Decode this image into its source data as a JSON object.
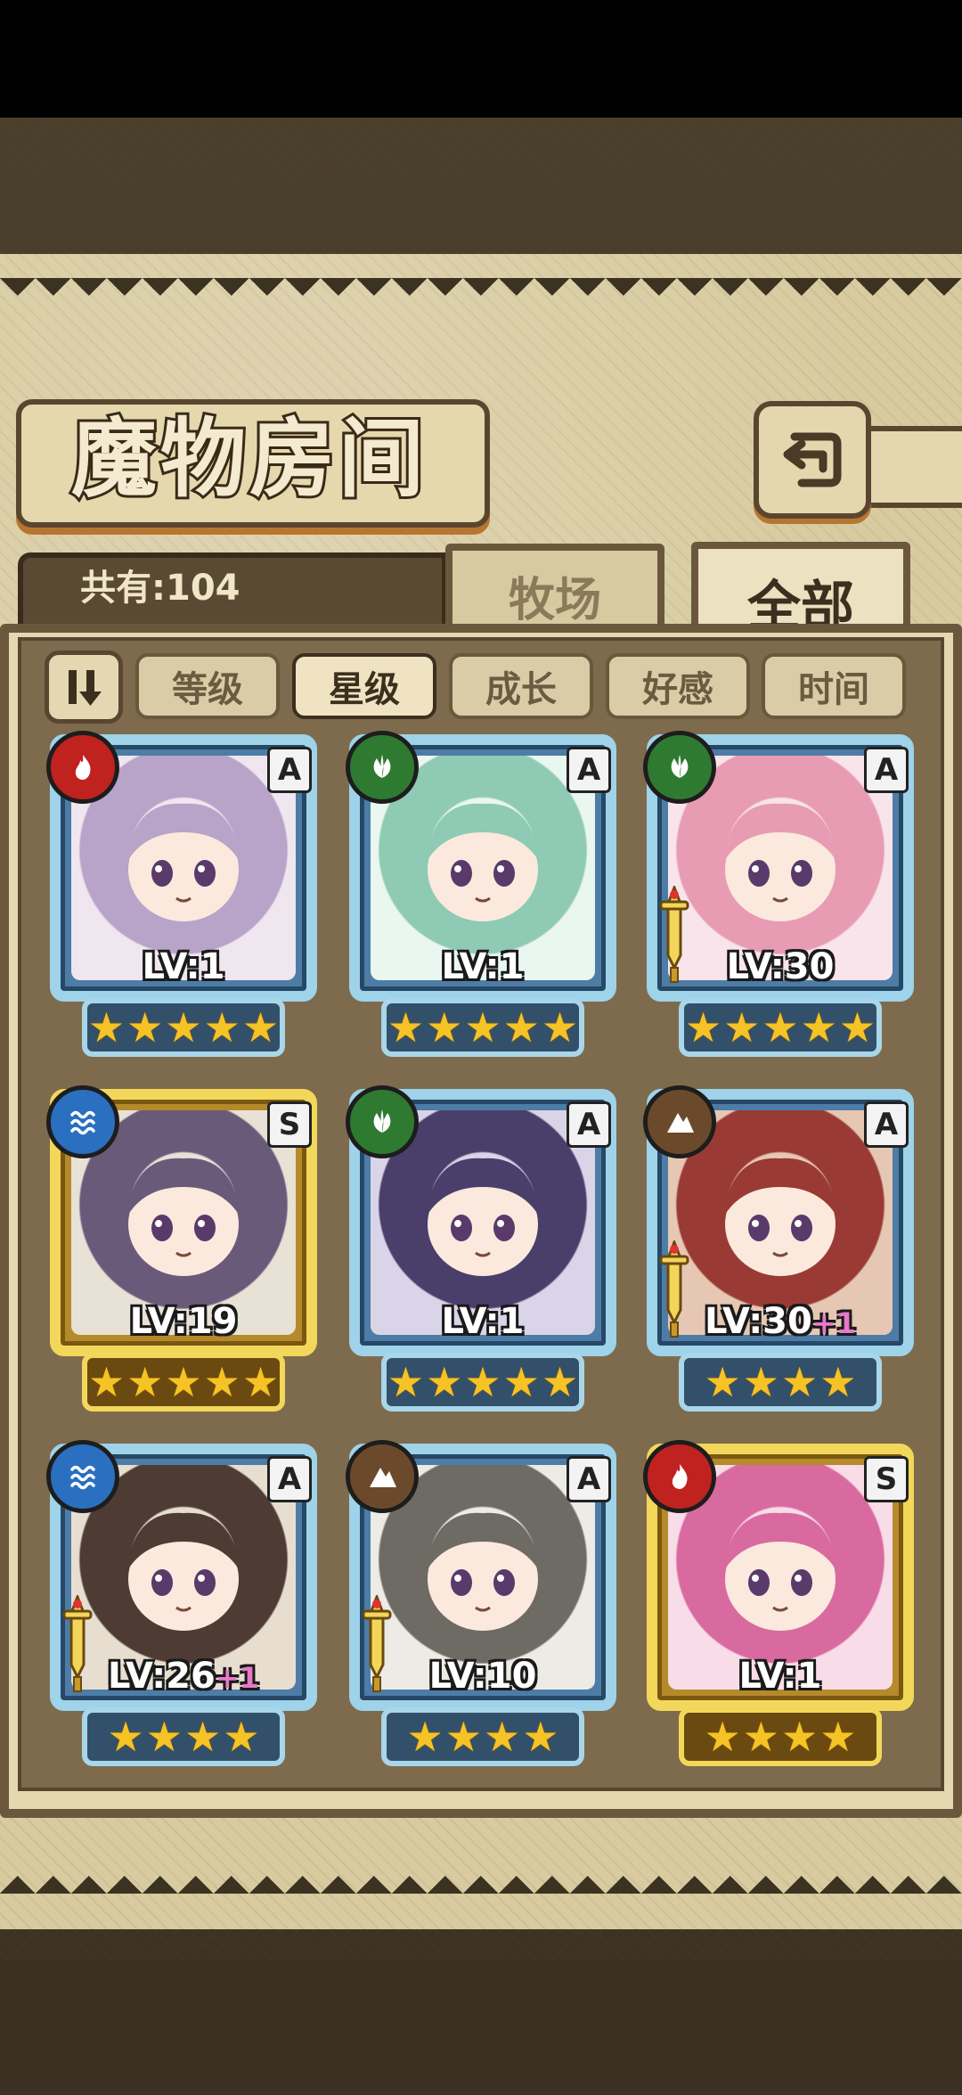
{
  "header": {
    "title": "魔物房间",
    "count_label": "共有:104"
  },
  "tabs": [
    {
      "label": "牧场"
    },
    {
      "label": "全部"
    }
  ],
  "filters": [
    {
      "label": "等级"
    },
    {
      "label": "星级",
      "active": true
    },
    {
      "label": "成长"
    },
    {
      "label": "好感"
    },
    {
      "label": "时间"
    }
  ],
  "monsters": [
    {
      "level": "LV:1",
      "plus": "",
      "element": "fire",
      "rank": "A",
      "stars": 5,
      "frame": "blue",
      "weapon": false
    },
    {
      "level": "LV:1",
      "plus": "",
      "element": "leaf",
      "rank": "A",
      "stars": 5,
      "frame": "blue",
      "weapon": false
    },
    {
      "level": "LV:30",
      "plus": "",
      "element": "leaf",
      "rank": "A",
      "stars": 5,
      "frame": "blue",
      "weapon": true
    },
    {
      "level": "LV:19",
      "plus": "",
      "element": "water",
      "rank": "S",
      "stars": 5,
      "frame": "gold",
      "weapon": false
    },
    {
      "level": "LV:1",
      "plus": "",
      "element": "leaf",
      "rank": "A",
      "stars": 5,
      "frame": "blue",
      "weapon": false
    },
    {
      "level": "LV:30",
      "plus": "+1",
      "element": "earth",
      "rank": "A",
      "stars": 4,
      "frame": "blue",
      "weapon": true
    },
    {
      "level": "LV:26",
      "plus": "+1",
      "element": "water",
      "rank": "A",
      "stars": 4,
      "frame": "blue",
      "weapon": true
    },
    {
      "level": "LV:10",
      "plus": "",
      "element": "earth",
      "rank": "A",
      "stars": 4,
      "frame": "blue",
      "weapon": true
    },
    {
      "level": "LV:1",
      "plus": "",
      "element": "fire",
      "rank": "S",
      "stars": 4,
      "frame": "gold",
      "weapon": false
    }
  ],
  "colors": {
    "parchment": "#d8cba0",
    "frame_blue": "#9ed3ea",
    "frame_gold": "#f2d75b",
    "star": "#f5c325"
  }
}
